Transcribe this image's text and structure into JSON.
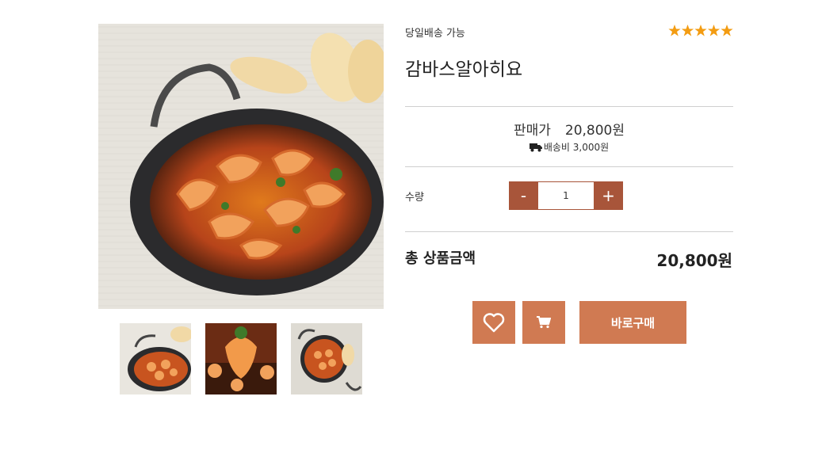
{
  "product": {
    "badge": "당일배송 가능",
    "title": "감바스알아히요",
    "rating": 5,
    "rating_max": 5,
    "image": "shrimp-gambas-in-pan",
    "thumbnails": [
      "gambas-pan-side",
      "gambas-shrimp-closeup",
      "gambas-pan-top"
    ]
  },
  "price": {
    "label": "판매가",
    "amount": "20,800원"
  },
  "shipping": {
    "icon": "truck-icon",
    "text": "배송비 3,000원"
  },
  "quantity": {
    "label": "수량",
    "value": "1",
    "minus": "-",
    "plus": "+"
  },
  "total": {
    "label": "총 상품금액",
    "amount": "20,800원"
  },
  "actions": {
    "wishlist_icon": "heart-icon",
    "cart_icon": "cart-icon",
    "buy_label": "바로구매"
  },
  "colors": {
    "accent": "#d07a52",
    "qty_button": "#a8553a",
    "star": "#f39c12"
  }
}
